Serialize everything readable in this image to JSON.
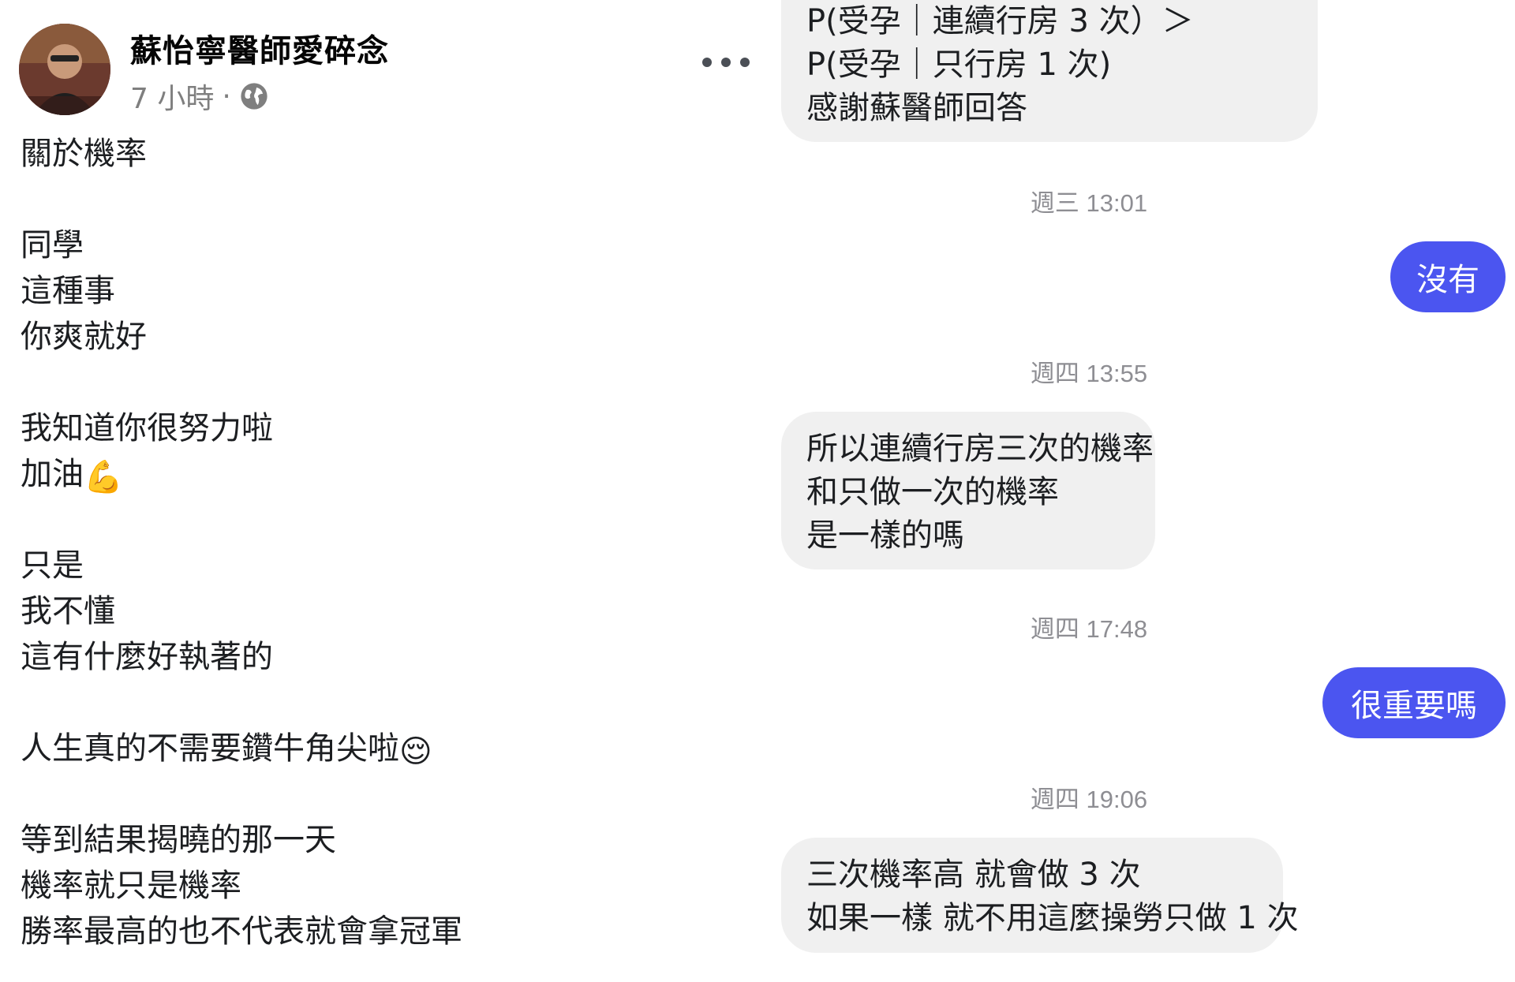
{
  "post": {
    "author_name": "蘇怡寧醫師愛碎念",
    "time": "7 小時",
    "separator": "·",
    "privacy_icon": "globe-icon",
    "more_icon": "more-options-icon",
    "lines": [
      "關於機率",
      "",
      "同學",
      "這種事",
      "你爽就好",
      "",
      "我知道你很努力啦",
      "加油",
      "",
      "只是",
      "我不懂",
      "這有什麼好執著的",
      "",
      "人生真的不需要鑽牛角尖啦",
      "",
      "等到結果揭曉的那一天",
      "機率就只是機率",
      "勝率最高的也不代表就會拿冠軍"
    ],
    "emoji_flexed_biceps": "💪",
    "emoji_relieved": "😌"
  },
  "chat": {
    "msg1_lines": [
      "P(受孕｜連續行房 3 次）＞",
      "P(受孕｜只行房 1 次)",
      "感謝蘇醫師回答"
    ],
    "ts1": "週三 13:01",
    "reply1": "沒有",
    "ts2": "週四 13:55",
    "msg2_lines": [
      "所以連續行房三次的機率",
      "和只做一次的機率",
      "是一樣的嗎"
    ],
    "ts3": "週四 17:48",
    "reply2": "很重要嗎",
    "ts4": "週四 19:06",
    "msg3_lines": [
      "三次機率高 就會做 3 次",
      "如果一樣 就不用這麼操勞只做 1 次"
    ],
    "colors": {
      "outgoing_bubble": "#4b55f0",
      "incoming_bubble": "#f0f0f0",
      "timestamp": "#8e8e93"
    }
  }
}
